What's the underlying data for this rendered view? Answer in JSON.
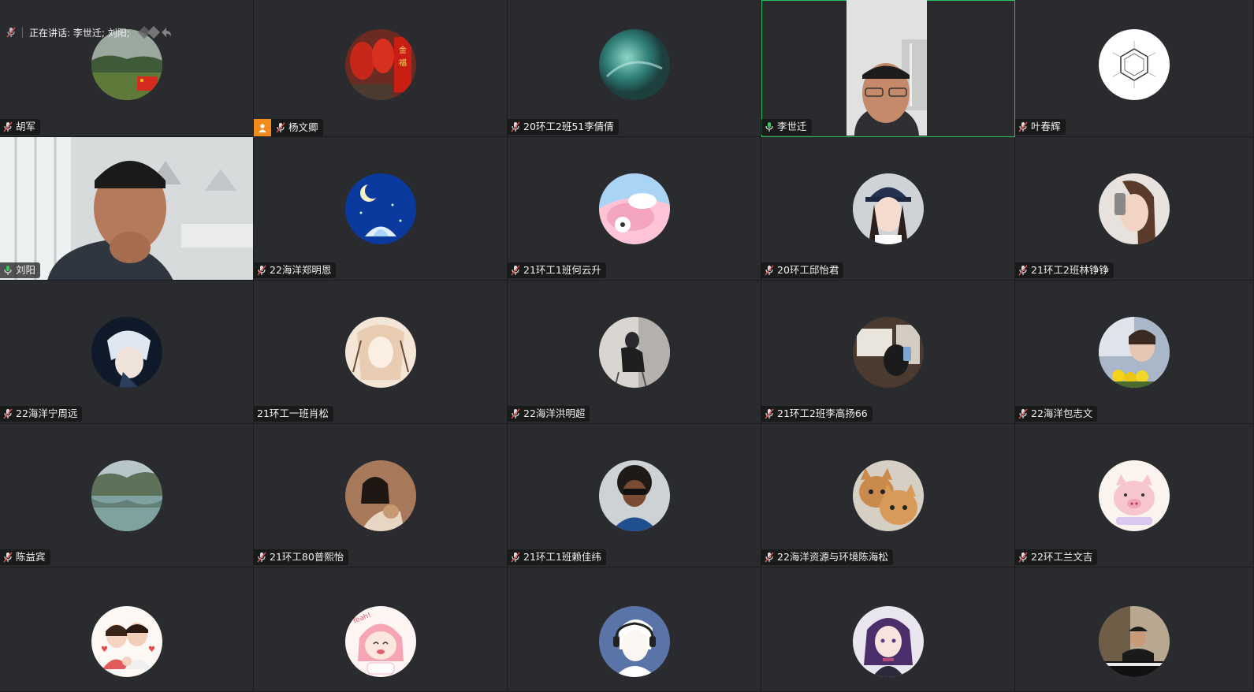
{
  "speaking": {
    "label": "正在讲话: 李世迁; 刘阳;"
  },
  "colors": {
    "tile_bg": "#292b2e",
    "active_border": "#2ec25e",
    "mic_muted": "#e05050",
    "mic_active": "#34c759",
    "host_badge": "#f28a1e"
  },
  "participants": [
    {
      "name": "胡军",
      "mic": "muted",
      "avatar": "landscape-flag"
    },
    {
      "name": "杨文卿",
      "mic": "muted",
      "host": true,
      "avatar": "red-lanterns"
    },
    {
      "name": "20环工2班51李倩倩",
      "mic": "muted",
      "avatar": "teal-abstract"
    },
    {
      "name": "李世迁",
      "mic": "active",
      "video": true,
      "speaking": true
    },
    {
      "name": "叶春辉",
      "mic": "muted",
      "avatar": "benzene-ring"
    },
    {
      "name": "刘阳",
      "mic": "active",
      "video": true
    },
    {
      "name": "22海洋郑明恩",
      "mic": "muted",
      "avatar": "moon-lotus"
    },
    {
      "name": "21环工1班何云升",
      "mic": "muted",
      "avatar": "cartoon-pink"
    },
    {
      "name": "20环工邱怡君",
      "mic": "muted",
      "avatar": "girl-cap"
    },
    {
      "name": "21环工2班林铮铮",
      "mic": "muted",
      "avatar": "girl-phone"
    },
    {
      "name": "22海洋宁周远",
      "mic": "muted",
      "avatar": "anime-white-hair"
    },
    {
      "name": "21环工一班肖松",
      "mic": "none",
      "avatar": "anime-girl-sketch"
    },
    {
      "name": "22海洋洪明超",
      "mic": "muted",
      "avatar": "person-chair"
    },
    {
      "name": "21环工2班李高扬66",
      "mic": "muted",
      "avatar": "cafe-window"
    },
    {
      "name": "22海洋包志文",
      "mic": "muted",
      "avatar": "boy-flowers"
    },
    {
      "name": "陈益宾",
      "mic": "muted",
      "avatar": "lake"
    },
    {
      "name": "21环工80普熙怡",
      "mic": "muted",
      "avatar": "girl-cat"
    },
    {
      "name": "21环工1班赖佳纬",
      "mic": "muted",
      "avatar": "kid-sunglasses"
    },
    {
      "name": "22海洋资源与环境陈海松",
      "mic": "muted",
      "avatar": "two-cats"
    },
    {
      "name": "22环工兰文吉",
      "mic": "muted",
      "avatar": "pink-pig"
    },
    {
      "name": "",
      "mic": "none",
      "avatar": "family-cartoon"
    },
    {
      "name": "",
      "mic": "none",
      "avatar": "yeah-girl"
    },
    {
      "name": "",
      "mic": "none",
      "avatar": "headphone-boy"
    },
    {
      "name": "",
      "mic": "none",
      "avatar": "purple-hair-girl"
    },
    {
      "name": "",
      "mic": "none",
      "avatar": "pianist"
    }
  ]
}
